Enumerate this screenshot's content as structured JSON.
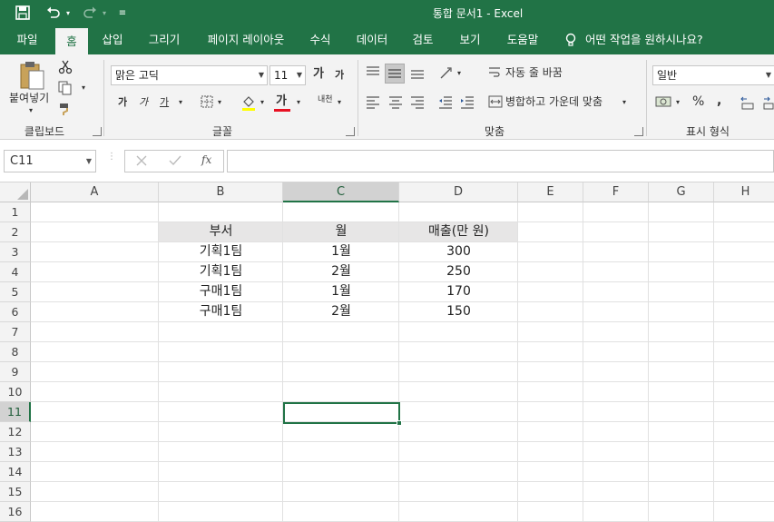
{
  "titlebar": {
    "title": "통합 문서1  -  Excel",
    "bg": "#217346"
  },
  "menu": {
    "tabs": [
      "파일",
      "홈",
      "삽입",
      "그리기",
      "페이지 레이아웃",
      "수식",
      "데이터",
      "검토",
      "보기",
      "도움말"
    ],
    "active": "홈",
    "tell_me": "어떤 작업을 원하시나요?"
  },
  "ribbon": {
    "clipboard": {
      "paste_label": "붙여넣기",
      "group_label": "클립보드"
    },
    "font": {
      "font_name": "맑은 고딕",
      "font_size": "11",
      "grow_label": "가",
      "shrink_label": "가",
      "bold_label": "가",
      "italic_label": "가",
      "underline_label": "가",
      "font_color_label": "가",
      "phonetic_label": "내천",
      "group_label": "글꼴",
      "font_color": "#e81123"
    },
    "alignment": {
      "wrap_text": "자동 줄 바꿈",
      "merge_center": "병합하고 가운데 맞춤",
      "group_label": "맞춤"
    },
    "number": {
      "format": "일반",
      "percent": "%",
      "comma": ",",
      "group_label": "표시 형식"
    }
  },
  "formula_bar": {
    "name_box": "C11",
    "fx_label": "fx",
    "formula": ""
  },
  "sheet": {
    "columns": [
      "A",
      "B",
      "C",
      "D",
      "E",
      "F",
      "G",
      "H"
    ],
    "selected_column": "C",
    "rows": [
      "1",
      "2",
      "3",
      "4",
      "5",
      "6",
      "7",
      "8",
      "9",
      "10",
      "11",
      "12",
      "13",
      "14",
      "15",
      "16"
    ],
    "selected_row": "11",
    "table": {
      "headers": [
        "부서",
        "월",
        "매출(만 원)"
      ],
      "data": [
        [
          "기획1팀",
          "1월",
          "300"
        ],
        [
          "기획1팀",
          "2월",
          "250"
        ],
        [
          "구매1팀",
          "1월",
          "170"
        ],
        [
          "구매1팀",
          "2월",
          "150"
        ]
      ]
    },
    "header_fill": "#e7e6e6",
    "selection_color": "#217346"
  }
}
